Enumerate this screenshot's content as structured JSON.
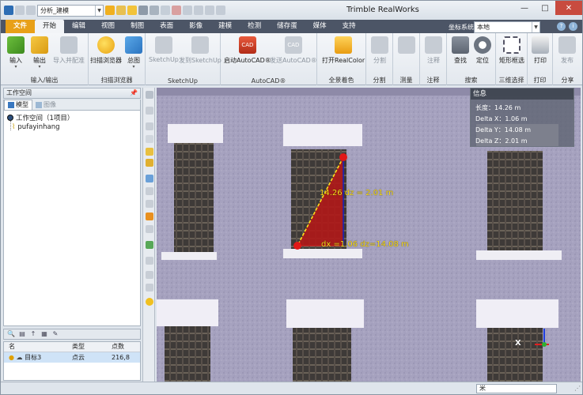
{
  "title_bar": {
    "app_title": "Trimble RealWorks",
    "quick_combo_value": "分析_建模",
    "window_controls": {
      "minimize": "—",
      "maximize": "□",
      "close": "✕"
    }
  },
  "ribbon_tabs": [
    "文件",
    "开始",
    "编辑",
    "视图",
    "制图",
    "表面",
    "影像",
    "建模",
    "检测",
    "储存蛋",
    "媒体",
    "支持"
  ],
  "active_tab": "开始",
  "coordinate_system": {
    "label": "坐标系统",
    "value": "本地"
  },
  "ribbon_groups": [
    {
      "name": "输入/输出",
      "buttons": [
        {
          "label": "输入",
          "icon": "import-icon"
        },
        {
          "label": "输出",
          "icon": "export-icon"
        },
        {
          "label": "导入并配准",
          "icon": "import-register-icon"
        }
      ]
    },
    {
      "name": "扫描浏览器",
      "buttons": [
        {
          "label": "扫描浏览器",
          "icon": "scan-explorer-icon"
        },
        {
          "label": "总图",
          "icon": "overview-icon"
        }
      ]
    },
    {
      "name": "SketchUp",
      "buttons": [
        {
          "label": "SketchUp",
          "icon": "sketchup-icon"
        },
        {
          "label": "发到SketchUp",
          "icon": "send-sketchup-icon"
        }
      ]
    },
    {
      "name": "AutoCAD®",
      "buttons": [
        {
          "label": "启动AutoCAD®",
          "icon": "autocad-icon"
        },
        {
          "label": "发送AutoCAD®",
          "icon": "send-autocad-icon"
        }
      ]
    },
    {
      "name": "全景着色",
      "buttons": [
        {
          "label": "打开RealColor",
          "icon": "realcolor-icon"
        }
      ]
    },
    {
      "name": "分割",
      "buttons": [
        {
          "label": "分割",
          "icon": "segment-icon"
        }
      ]
    },
    {
      "name": "测量",
      "buttons": [
        {
          "label": "",
          "icon": "measure-icon"
        }
      ]
    },
    {
      "name": "注释",
      "buttons": [
        {
          "label": "注释",
          "icon": "annotation-icon"
        }
      ]
    },
    {
      "name": "搜索",
      "buttons": [
        {
          "label": "查找",
          "icon": "find-icon"
        },
        {
          "label": "定位",
          "icon": "locate-icon"
        }
      ]
    },
    {
      "name": "三维选择",
      "buttons": [
        {
          "label": "矩形框选",
          "icon": "rect-select-icon"
        }
      ]
    },
    {
      "name": "打印",
      "buttons": [
        {
          "label": "打印",
          "icon": "print-icon"
        }
      ]
    },
    {
      "name": "分享",
      "buttons": [
        {
          "label": "发布",
          "icon": "publish-icon"
        }
      ]
    }
  ],
  "workspace": {
    "title": "工作空间",
    "tabs": [
      "模型",
      "图像"
    ],
    "tree": {
      "root": "工作空间（1项目）",
      "child": "pufayinhang"
    },
    "list_headers": [
      "名",
      "类型",
      "点数"
    ],
    "list_rows": [
      {
        "name": "目标3",
        "type": "点云",
        "points": "216,8"
      }
    ]
  },
  "info_panel": {
    "title": "信息",
    "lines": [
      "长度：14.26 m",
      "Delta X：1.06 m",
      "Delta Y：14.08 m",
      "Delta Z：2.01 m"
    ]
  },
  "measurement_labels": {
    "diagonal": "14.26 dz = 2.01 m",
    "bottom": "dx =1.06 dz=14.08 m"
  },
  "axis_label": "X",
  "status_bar": {
    "unit": "米"
  },
  "colors": {
    "ribbon_tab_bg": "#4c5566",
    "file_tab": "#e8a018",
    "measure_fill": "#b01818",
    "measure_text": "#ffe01a",
    "close_button": "#c84b3f"
  }
}
